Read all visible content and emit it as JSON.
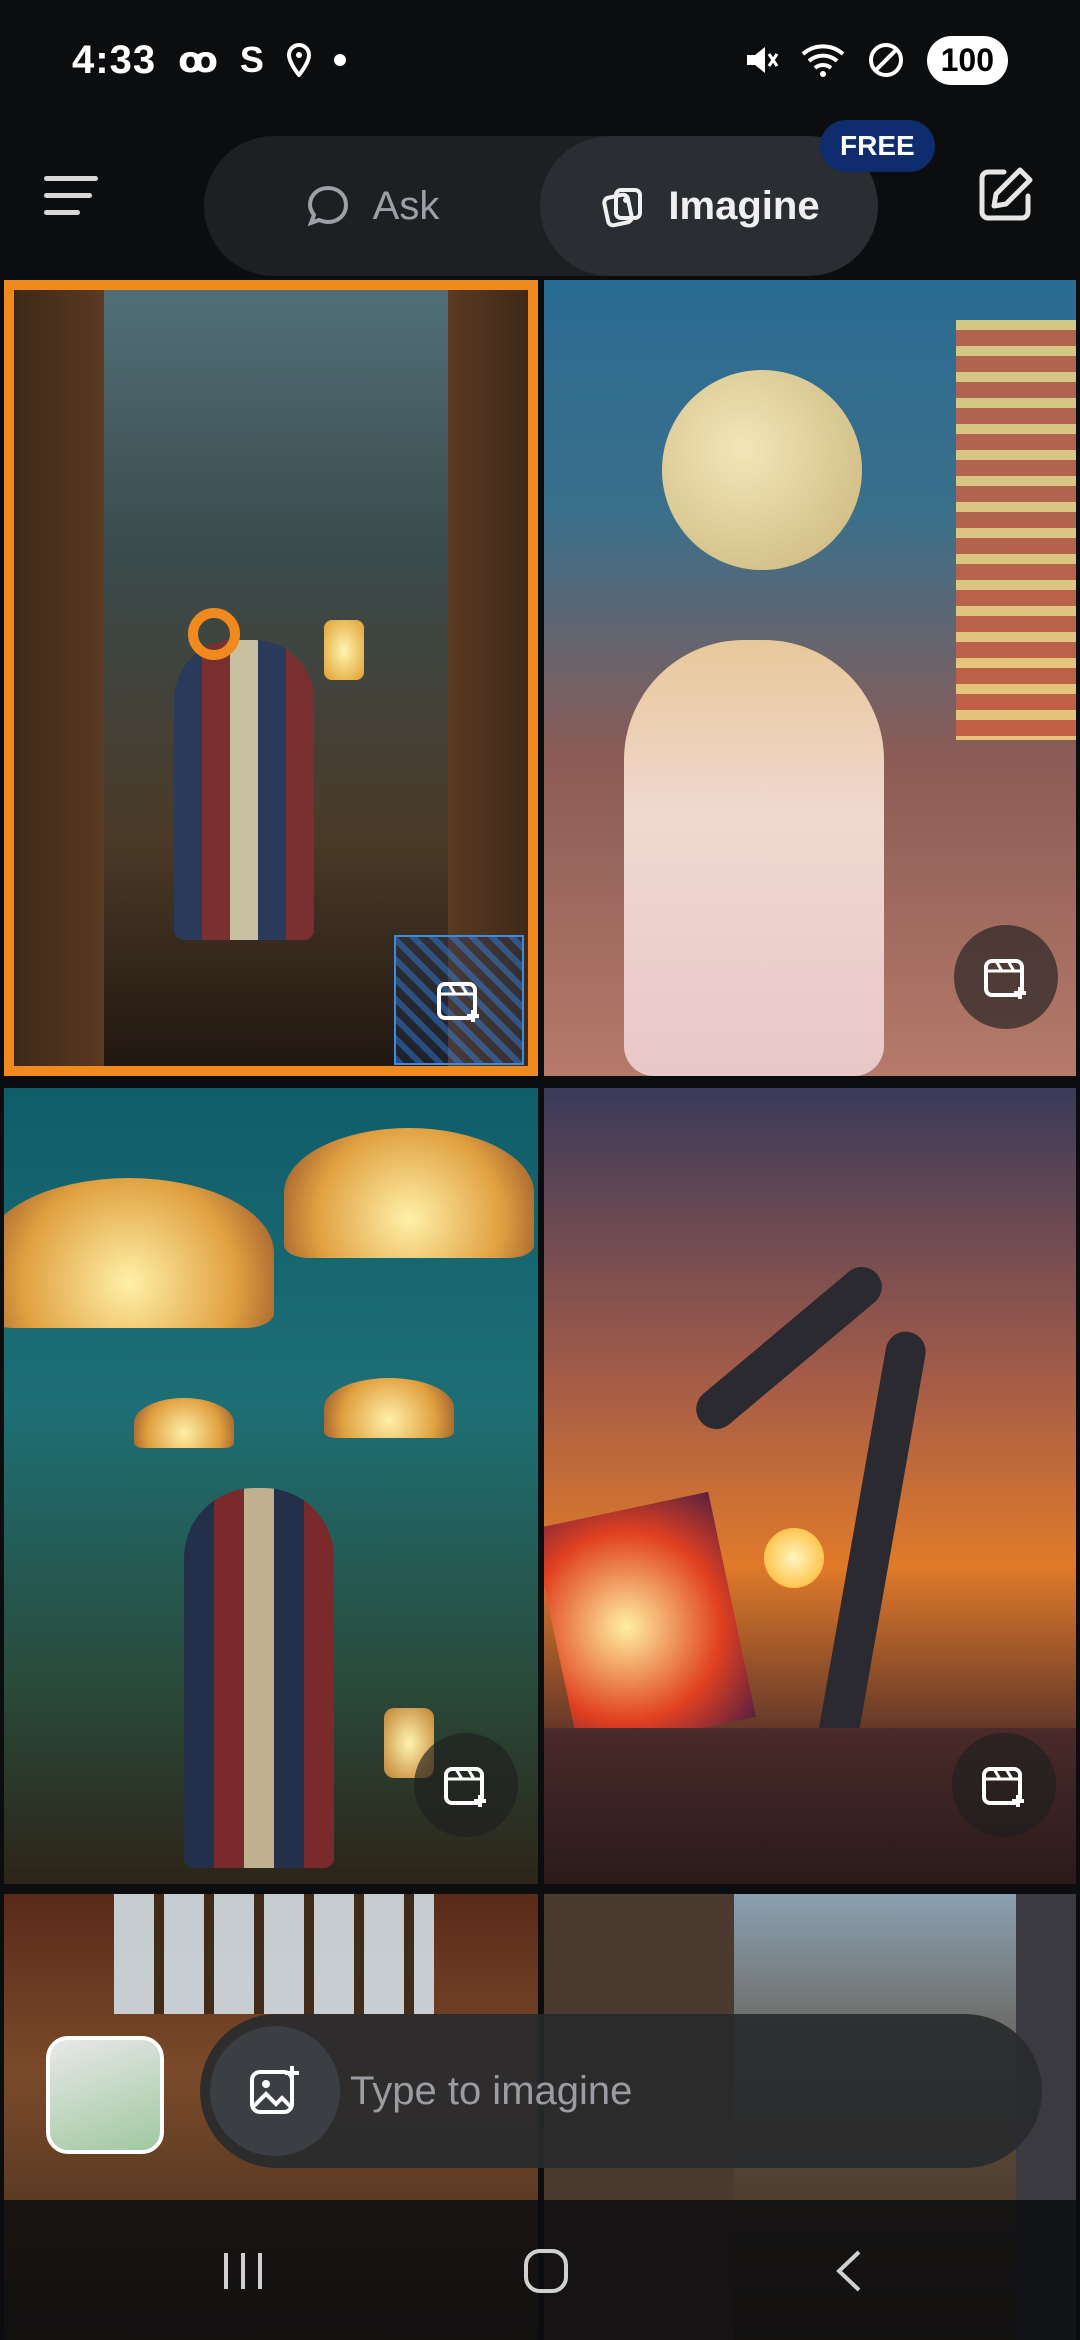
{
  "status_bar": {
    "time": "4:33",
    "battery": "100",
    "left_icons": [
      "swirl-icon",
      "s-icon",
      "location-icon",
      "dot-icon"
    ],
    "right_icons": [
      "mute-icon",
      "wifi-icon",
      "do-not-disturb-icon",
      "battery-icon"
    ]
  },
  "header": {
    "tabs": [
      {
        "label": "Ask",
        "icon": "chat-bubble-icon",
        "selected": false
      },
      {
        "label": "Imagine",
        "icon": "imagine-icon",
        "selected": true
      }
    ],
    "free_badge": "FREE",
    "menu_icon": "menu-icon",
    "edit_icon": "edit-icon"
  },
  "gallery": {
    "tiles": [
      {
        "subject": "library-staircase-lanterns",
        "selected": true
      },
      {
        "subject": "child-moon-carnival",
        "selected": false
      },
      {
        "subject": "glowing-mushrooms-child",
        "selected": false
      },
      {
        "subject": "robot-arm-painting-sunset",
        "selected": false
      },
      {
        "subject": "greenhouse-skylight",
        "selected": false
      },
      {
        "subject": "city-buildings",
        "selected": false
      }
    ],
    "tile_action_icon": "add-to-collection-icon"
  },
  "composer": {
    "placeholder": "Type to imagine",
    "attach_icon": "image-plus-icon"
  },
  "nav": {
    "icons": [
      "recents-icon",
      "home-icon",
      "back-icon"
    ]
  },
  "colors": {
    "background": "#0c0d0f",
    "accent_orange": "#f08a1e",
    "badge_blue": "#0f2d6e"
  }
}
